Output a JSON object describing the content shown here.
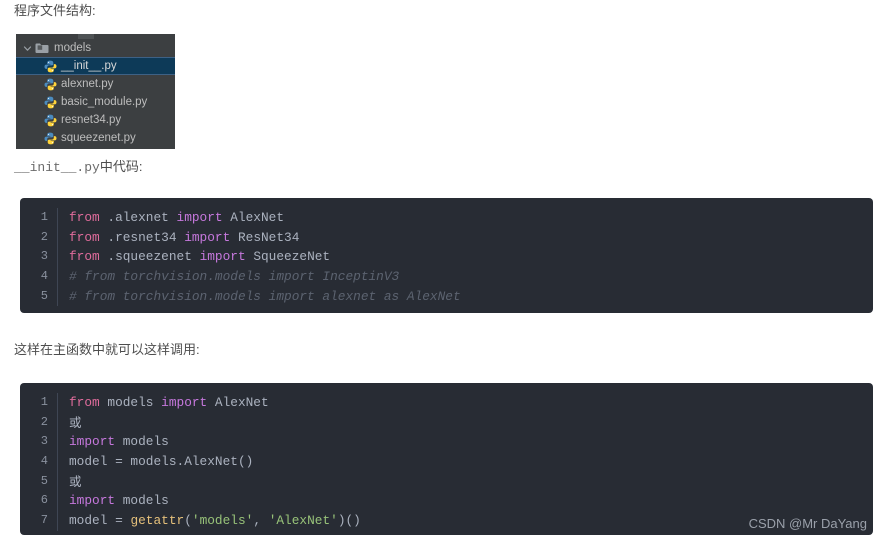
{
  "captions": {
    "structure": "程序文件结构:",
    "init_prefix": "__init__.py",
    "init_suffix": "中代码:",
    "call": "这样在主函数中就可以这样调用:"
  },
  "file_tree": {
    "folder": {
      "label": "models",
      "icon": "folder-icon",
      "chevron": "chevron-down-icon"
    },
    "files": [
      {
        "label": "__init__.py",
        "icon": "python-file-icon",
        "selected": true
      },
      {
        "label": "alexnet.py",
        "icon": "python-file-icon",
        "selected": false
      },
      {
        "label": "basic_module.py",
        "icon": "python-file-icon",
        "selected": false
      },
      {
        "label": "resnet34.py",
        "icon": "python-file-icon",
        "selected": false
      },
      {
        "label": "squeezenet.py",
        "icon": "python-file-icon",
        "selected": false
      }
    ]
  },
  "code_blocks": [
    {
      "id": "init",
      "lines": [
        {
          "no": "1",
          "tokens": [
            {
              "t": "from",
              "c": "kw2"
            },
            {
              "t": " .alexnet ",
              "c": "ident"
            },
            {
              "t": "import",
              "c": "kw"
            },
            {
              "t": " AlexNet",
              "c": "ident"
            }
          ]
        },
        {
          "no": "2",
          "tokens": [
            {
              "t": "from",
              "c": "kw2"
            },
            {
              "t": " .resnet34 ",
              "c": "ident"
            },
            {
              "t": "import",
              "c": "kw"
            },
            {
              "t": " ResNet34",
              "c": "ident"
            }
          ]
        },
        {
          "no": "3",
          "tokens": [
            {
              "t": "from",
              "c": "kw2"
            },
            {
              "t": " .squeezenet ",
              "c": "ident"
            },
            {
              "t": "import",
              "c": "kw"
            },
            {
              "t": " SqueezeNet",
              "c": "ident"
            }
          ]
        },
        {
          "no": "4",
          "tokens": [
            {
              "t": "# from torchvision.models import InceptinV3",
              "c": "cmt"
            }
          ]
        },
        {
          "no": "5",
          "tokens": [
            {
              "t": "# from torchvision.models import alexnet as AlexNet",
              "c": "cmt"
            }
          ]
        }
      ]
    },
    {
      "id": "call",
      "lines": [
        {
          "no": "1",
          "tokens": [
            {
              "t": "from",
              "c": "kw2"
            },
            {
              "t": " models ",
              "c": "ident"
            },
            {
              "t": "import",
              "c": "kw"
            },
            {
              "t": " AlexNet",
              "c": "ident"
            }
          ]
        },
        {
          "no": "2",
          "tokens": [
            {
              "t": "或",
              "c": "cjk"
            }
          ]
        },
        {
          "no": "3",
          "tokens": [
            {
              "t": "import",
              "c": "kw"
            },
            {
              "t": " models",
              "c": "ident"
            }
          ]
        },
        {
          "no": "4",
          "tokens": [
            {
              "t": "model = models.AlexNet()",
              "c": "ident"
            }
          ]
        },
        {
          "no": "5",
          "tokens": [
            {
              "t": "或",
              "c": "cjk"
            }
          ]
        },
        {
          "no": "6",
          "tokens": [
            {
              "t": "import",
              "c": "kw"
            },
            {
              "t": " models",
              "c": "ident"
            }
          ]
        },
        {
          "no": "7",
          "tokens": [
            {
              "t": "model = ",
              "c": "ident"
            },
            {
              "t": "getattr",
              "c": "fn"
            },
            {
              "t": "(",
              "c": "ident"
            },
            {
              "t": "'models'",
              "c": "str"
            },
            {
              "t": ", ",
              "c": "ident"
            },
            {
              "t": "'AlexNet'",
              "c": "str"
            },
            {
              "t": ")()",
              "c": "ident"
            }
          ]
        }
      ]
    }
  ],
  "watermark": "CSDN @Mr DaYang"
}
